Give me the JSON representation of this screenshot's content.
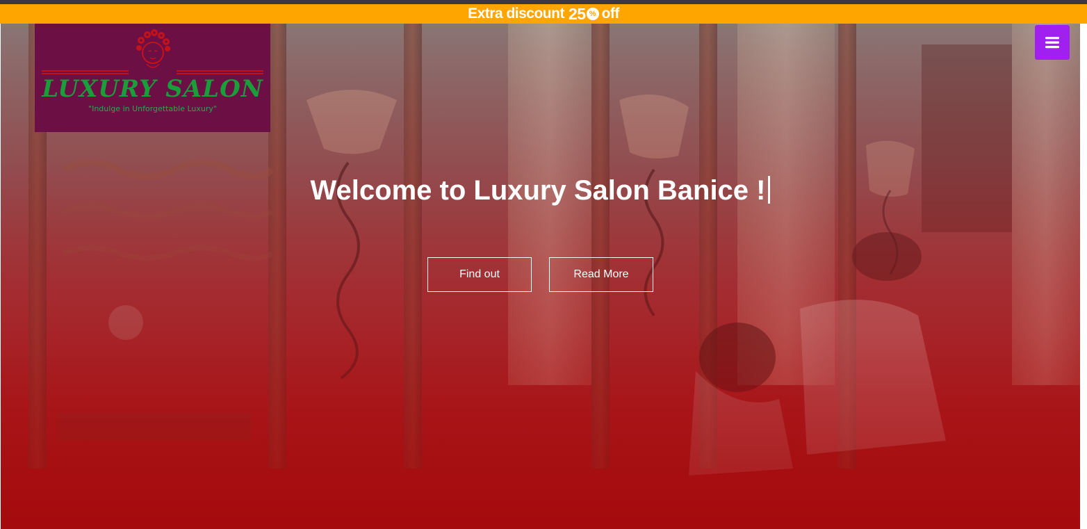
{
  "promo": {
    "prefix": "Extra discount",
    "amount": "25",
    "percent_icon": "percent-badge-icon",
    "suffix": "off"
  },
  "logo": {
    "brand": "LUXURY SALON",
    "tagline": "\"Indulge in Unforgettable Luxury\"",
    "icon": "woman-face-icon",
    "colors": {
      "background": "#6b0f45",
      "text": "#1a9e3a",
      "accent": "#c4121b"
    }
  },
  "nav": {
    "menu_icon": "hamburger-menu-icon",
    "menu_color": "#a020f0"
  },
  "hero": {
    "title": "Welcome to Luxury Salon Banice !",
    "buttons": {
      "find_out": "Find out",
      "read_more": "Read More"
    }
  },
  "colors": {
    "promo_bar": "#ffa500",
    "hero_tint": "#a50d0f"
  }
}
